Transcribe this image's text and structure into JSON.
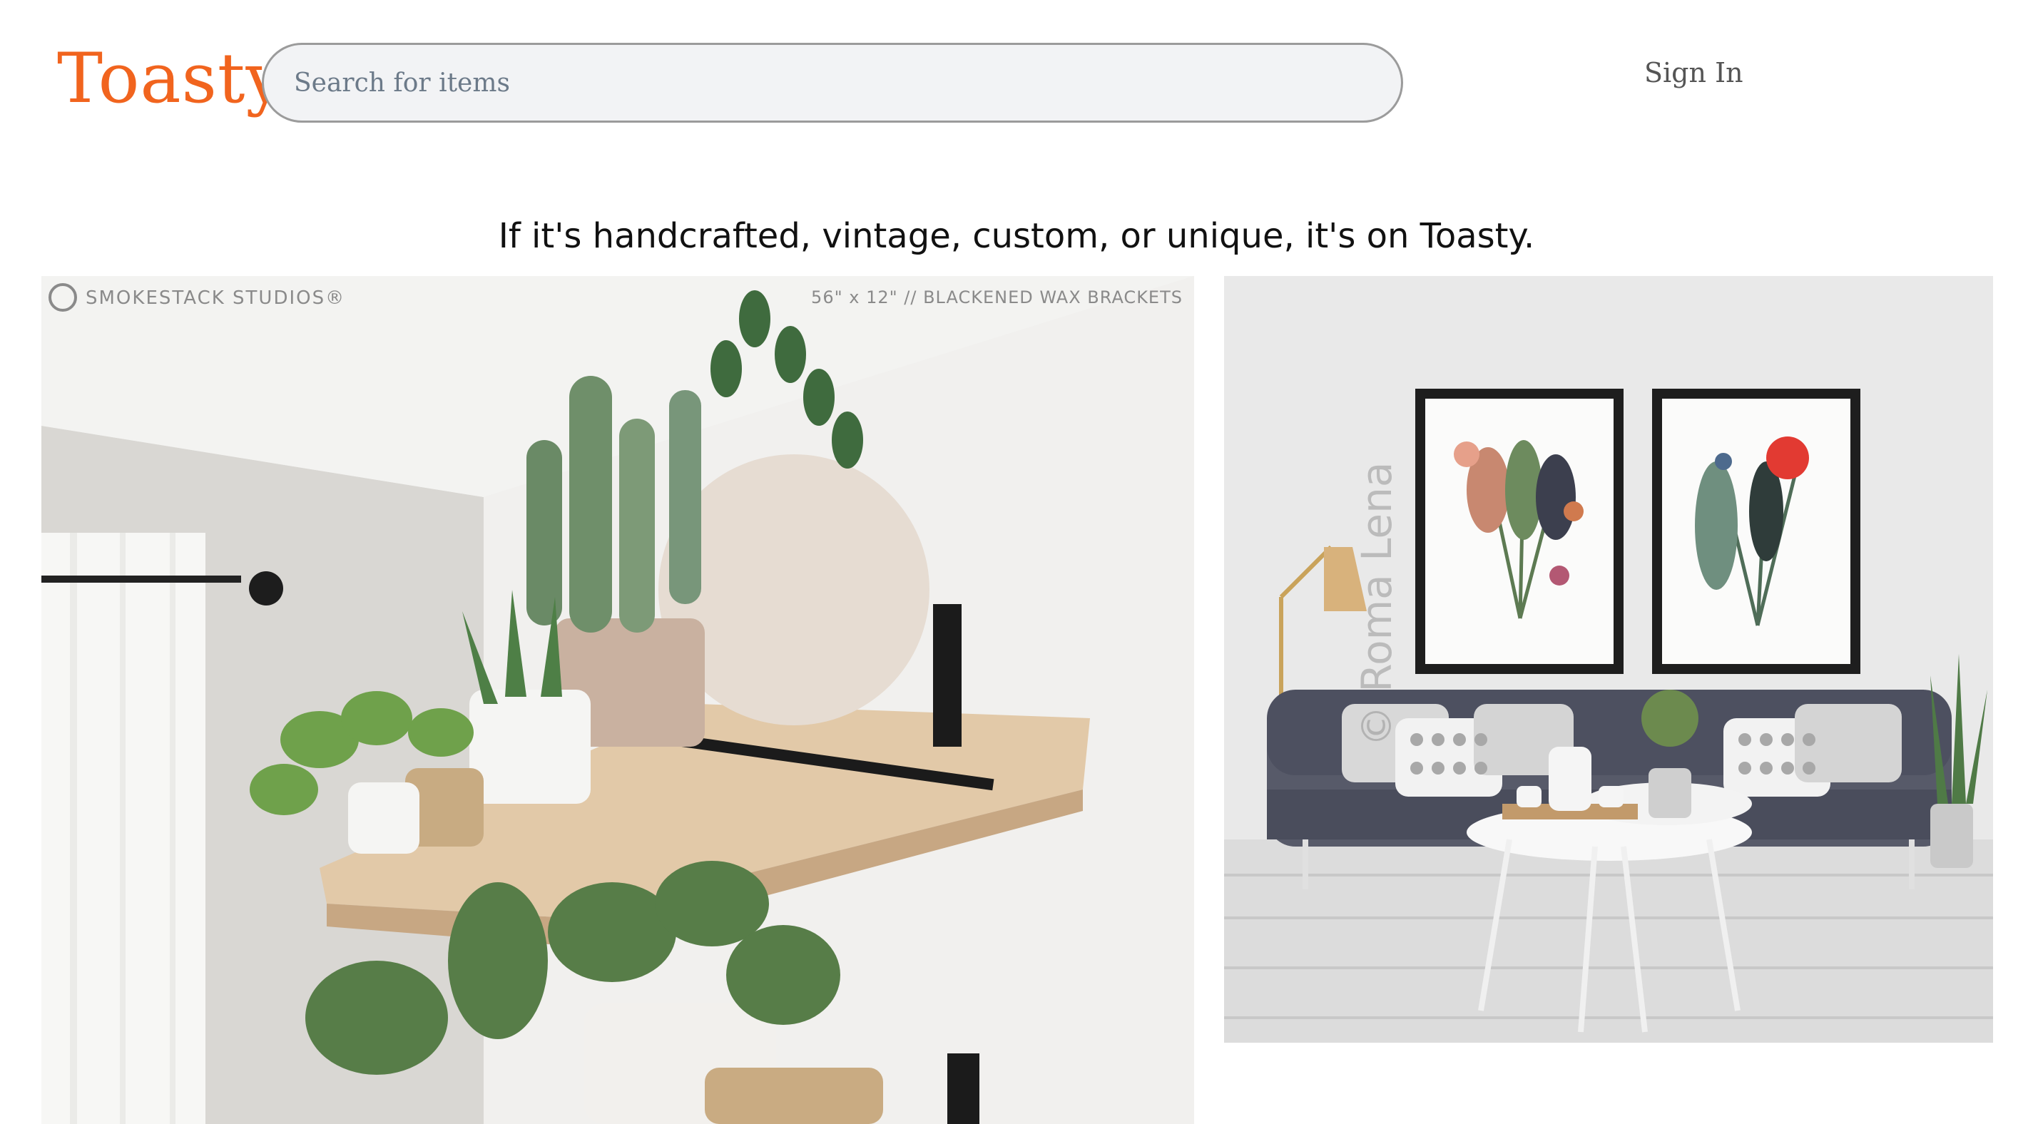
{
  "header": {
    "logo_text": "Toasty",
    "search_placeholder": "Search for items",
    "search_value": "",
    "signin_label": "Sign In"
  },
  "tagline": "If it's handcrafted, vintage, custom, or unique, it's on Toasty.",
  "images": {
    "left": {
      "subject": "floating wood shelf with potted plants and cacti",
      "brand_caption": "SMOKESTACK STUDIOS®",
      "size_caption": "56\" x 12\" // BLACKENED WAX BRACKETS"
    },
    "right": {
      "subject": "living room with two framed botanical prints above grey sofa",
      "watermark": "© Roma Lena"
    }
  },
  "colors": {
    "brand": "#f1641e",
    "search_bg": "#f2f3f5",
    "search_border": "#9b9b9b",
    "text": "#111111",
    "muted": "#555555"
  }
}
